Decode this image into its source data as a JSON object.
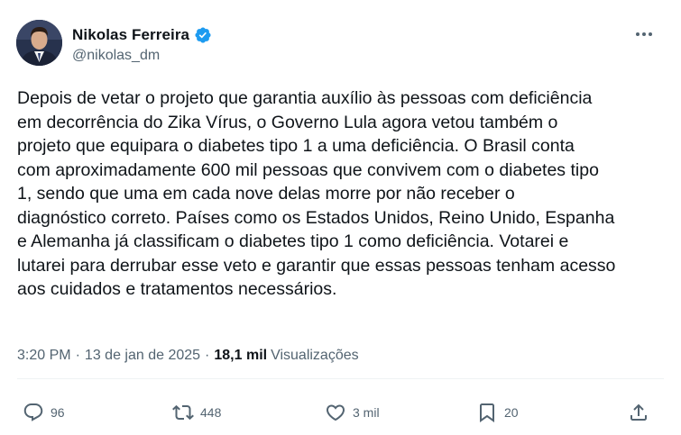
{
  "author": {
    "name": "Nikolas Ferreira",
    "handle": "@nikolas_dm",
    "verified_color": "#1d9bf0"
  },
  "tweet": {
    "text": "Depois de vetar o projeto que garantia auxílio às pessoas com deficiência\nem decorrência do Zika Vírus, o Governo Lula agora vetou também o\nprojeto que equipara o diabetes tipo 1 a uma deficiência. O Brasil conta\ncom aproximadamente 600 mil pessoas que convivem com o diabetes tipo\n1, sendo que uma em cada nove delas morre por não receber o\ndiagnóstico correto. Países como os Estados Unidos, Reino Unido, Espanha\ne Alemanha já classificam o diabetes tipo 1 como deficiência. Votarei e\nlutarei para derrubar esse veto e garantir que essas pessoas tenham acesso\naos cuidados e tratamentos necessários.",
    "time": "3:20 PM",
    "separator": "·",
    "date": "13 de jan de 2025",
    "views_count": "18,1 mil",
    "views_label": "Visualizações"
  },
  "actions": {
    "replies": "96",
    "retweets": "448",
    "likes": "3 mil",
    "bookmarks": "20"
  },
  "icons": {
    "more": "more-dots-icon",
    "reply": "reply-bubble-icon",
    "retweet": "retweet-icon",
    "like": "heart-icon",
    "bookmark": "bookmark-icon",
    "share": "share-upload-icon"
  },
  "colors": {
    "text": "#0f1419",
    "secondary": "#536471",
    "divider": "#eff3f4"
  }
}
